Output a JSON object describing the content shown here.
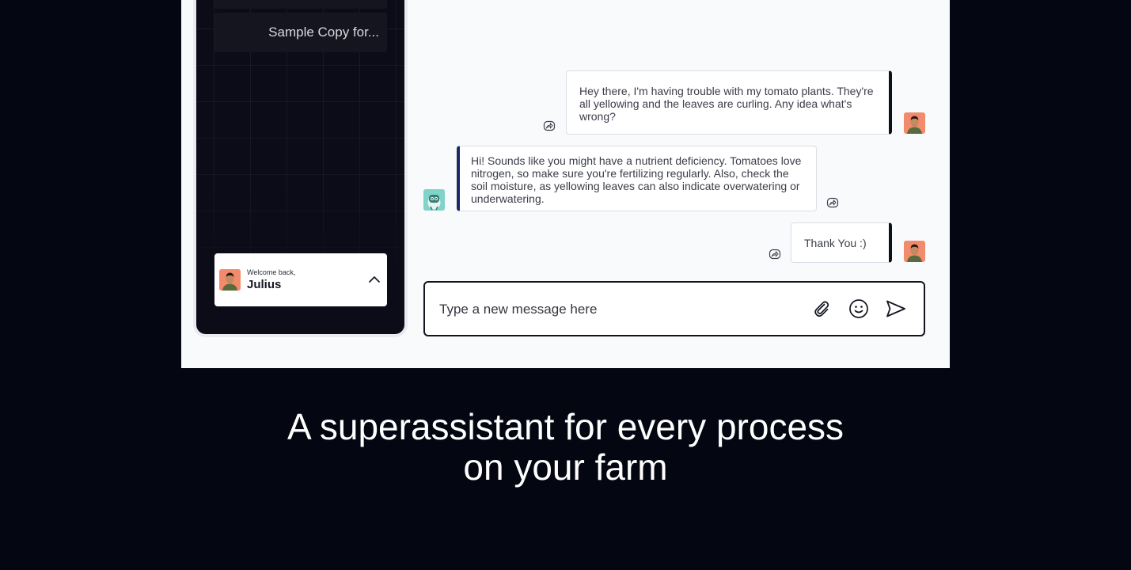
{
  "sidebar": {
    "history": [
      {
        "label": ""
      },
      {
        "label": "Sample Copy for..."
      }
    ],
    "user_card": {
      "welcome": "Welcome back,",
      "name": "Julius"
    }
  },
  "chat": {
    "messages": [
      {
        "role": "user",
        "text": "Hey there, I'm having trouble with my tomato plants. They're all yellowing and the leaves are curling. Any idea what's wrong?"
      },
      {
        "role": "assistant",
        "text": "Hi! Sounds like you might have a nutrient deficiency. Tomatoes love nitrogen, so make sure you're fertilizing regularly. Also, check the soil moisture, as yellowing leaves can also indicate overwatering or underwatering."
      },
      {
        "role": "user",
        "text": "Thank You :)"
      }
    ],
    "composer": {
      "placeholder": "Type a new message here",
      "value": ""
    }
  },
  "headline": {
    "line1": "A superassistant for every process",
    "line2": "on your farm"
  },
  "icons": {
    "attach": "paperclip-icon",
    "emoji": "smiley-icon",
    "send": "send-icon",
    "share": "share-icon",
    "chevron": "chevron-up-icon"
  },
  "colors": {
    "page_background": "#040612",
    "sidebar_background": "#0b0c18",
    "user_avatar": "#f28b6c",
    "bot_accent": "#172a63",
    "bot_avatar": "#7fd3c7"
  }
}
